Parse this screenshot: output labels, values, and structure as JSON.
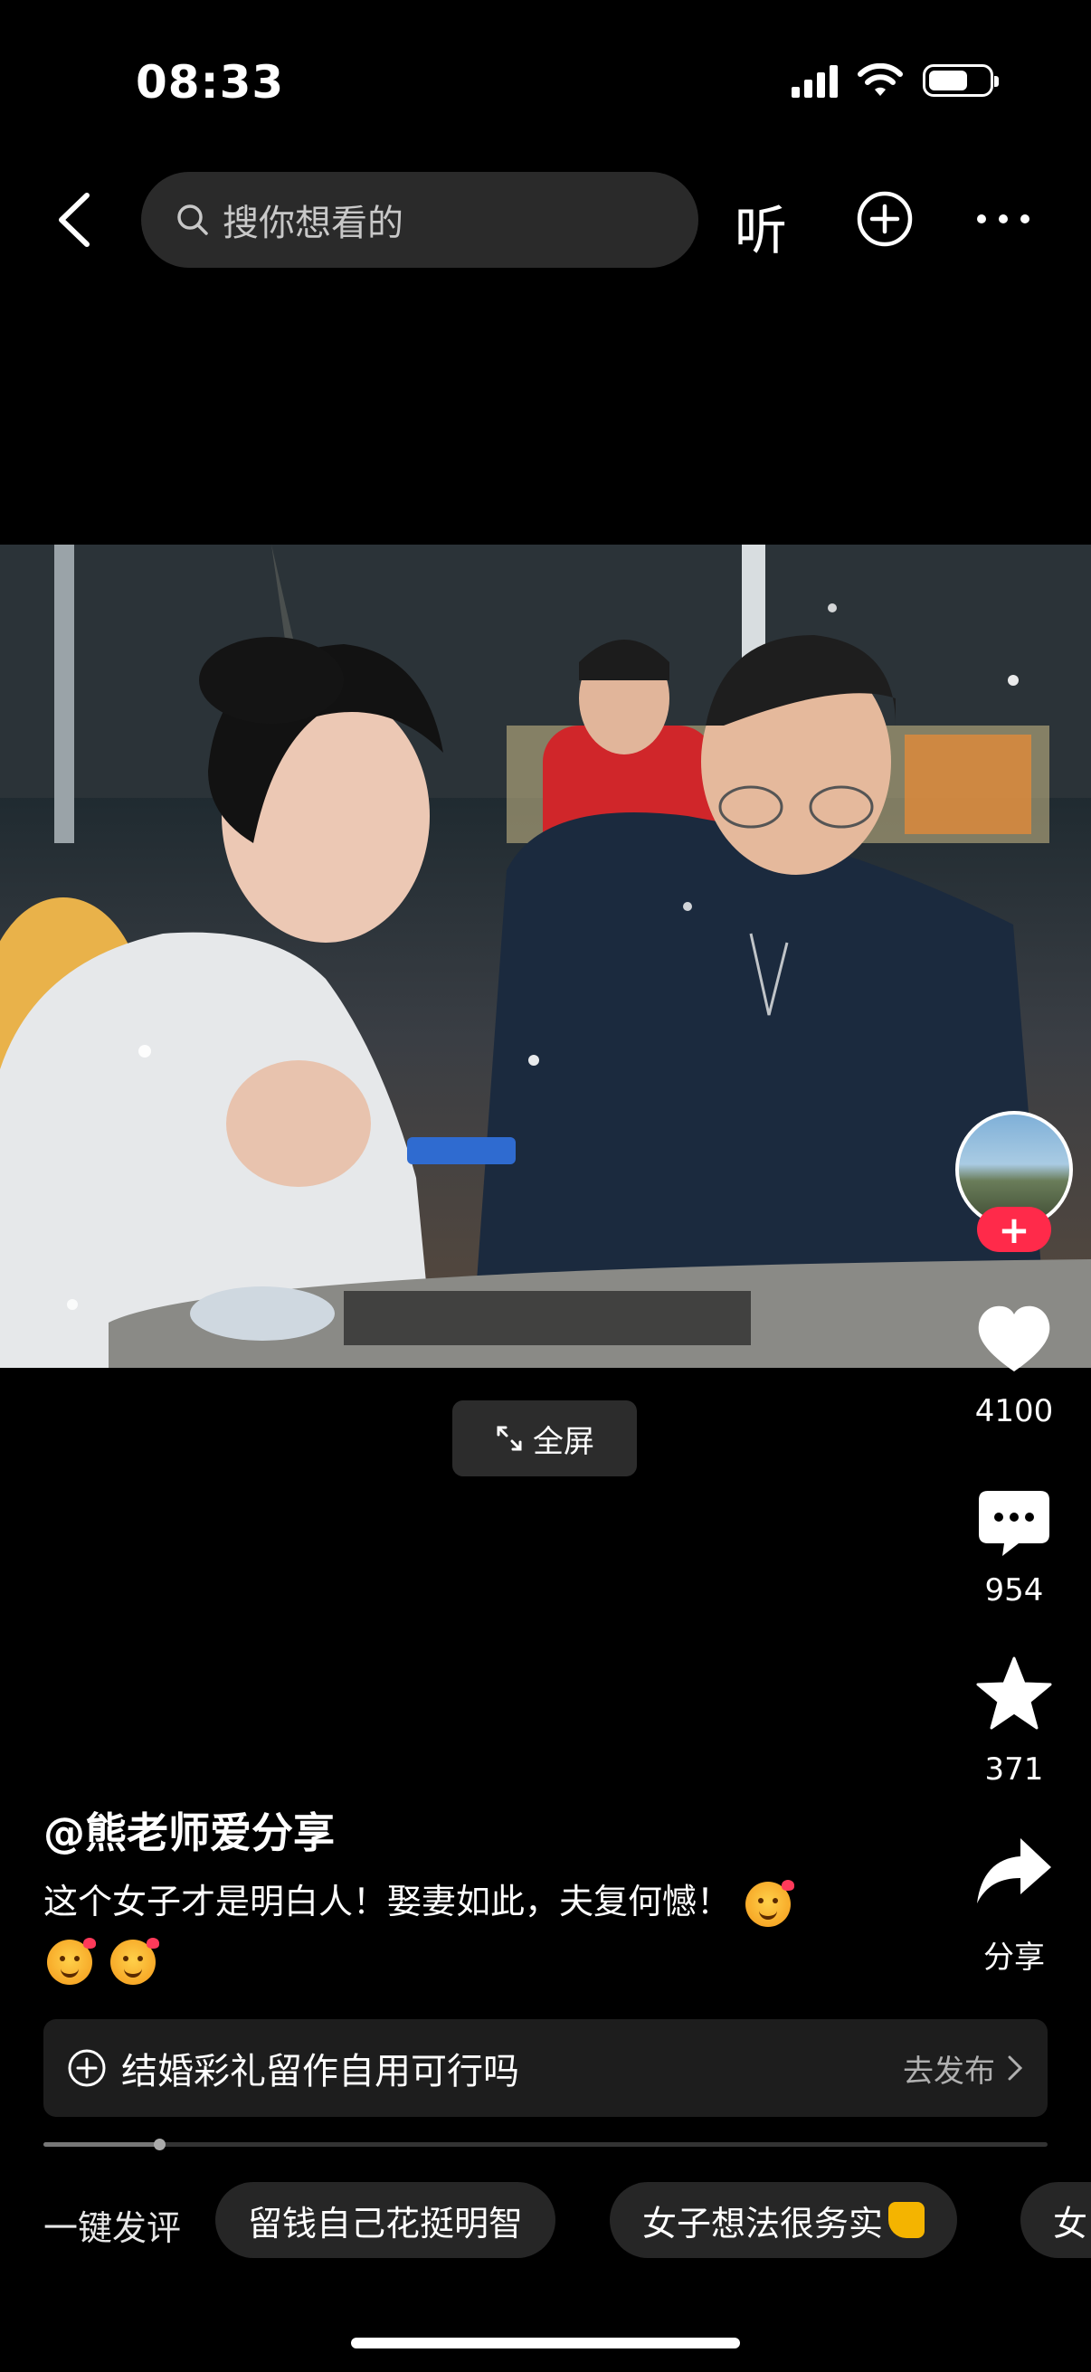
{
  "status_bar": {
    "time": "08:33"
  },
  "top_nav": {
    "search_placeholder": "搜你想看的",
    "listen_label": "听"
  },
  "video": {
    "fullscreen_label": "全屏"
  },
  "right_rail": {
    "like_count": "4100",
    "comment_count": "954",
    "favorite_count": "371",
    "share_label": "分享",
    "follow_symbol": "+"
  },
  "post": {
    "author": "@熊老师爱分享",
    "caption": "这个女子才是明白人！娶妻如此，夫复何憾！"
  },
  "topic_bar": {
    "text": "结婚彩礼留作自用可行吗",
    "action": "去发布"
  },
  "playback": {
    "progress": 0.115
  },
  "quick_comment": {
    "label": "一键发评",
    "chips": [
      "留钱自己花挺明智",
      "女子想法很务实",
      "女"
    ]
  }
}
